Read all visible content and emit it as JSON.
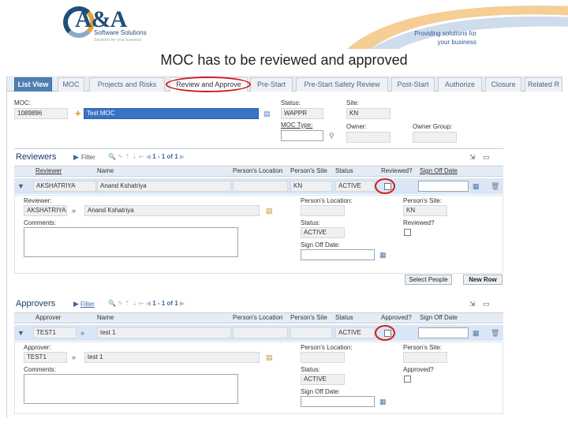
{
  "header": {
    "logo_text": "A&A",
    "logo_subtitle": "Software Solutions",
    "logo_tagline": "Solutions for your business",
    "tagline_line1": "Providing solutions for",
    "tagline_line2": "your business",
    "slide_title": "MOC has to be reviewed and approved"
  },
  "tabs": [
    {
      "label": "List View"
    },
    {
      "label": "MOC"
    },
    {
      "label": "Projects and Risks"
    },
    {
      "label": "Review and Approve"
    },
    {
      "label": "Pre-Start"
    },
    {
      "label": "Pre-Start Safety Review"
    },
    {
      "label": "Post-Start"
    },
    {
      "label": "Authorize"
    },
    {
      "label": "Closure"
    },
    {
      "label": "Related R"
    }
  ],
  "moc": {
    "moc_label": "MOC:",
    "moc_value": "1089896",
    "desc_value": "Test MOC",
    "status_label": "Status:",
    "status_value": "WAPPR",
    "site_label": "Site:",
    "site_value": "KN",
    "type_label": "MOC Type:",
    "owner_label": "Owner:",
    "owner_group_label": "Owner Group:"
  },
  "reviewers": {
    "title": "Reviewers",
    "filter": "Filter",
    "pager_text": "1 - 1 of 1",
    "columns": [
      "Reviewer",
      "Name",
      "Person's Location",
      "Person's Site",
      "Status",
      "Reviewed?",
      "Sign Off Date"
    ],
    "row": {
      "reviewer": "AKSHATRIYA",
      "name": "Anand Kshatriya",
      "location": "",
      "site": "KN",
      "status": "ACTIVE"
    },
    "detail": {
      "reviewer_label": "Reviewer:",
      "reviewer_value": "AKSHATRIYA",
      "name_value": "Anand Kshatriya",
      "location_label": "Person's Location:",
      "site_label": "Person's Site:",
      "site_value": "KN",
      "comments_label": "Comments:",
      "status_label": "Status:",
      "status_value": "ACTIVE",
      "reviewed_label": "Reviewed?",
      "signoff_label": "Sign Off Date:"
    },
    "select_people": "Select People",
    "new_row": "New Row"
  },
  "approvers": {
    "title": "Approvers",
    "filter": "Filter",
    "pager_text": "1 - 1 of 1",
    "columns": [
      "Approver",
      "Name",
      "Person's Location",
      "Person's Site",
      "Status",
      "Approved?",
      "Sign Off Date"
    ],
    "row": {
      "approver": "TEST1",
      "name": "test 1",
      "location": "",
      "site": "",
      "status": "ACTIVE"
    },
    "detail": {
      "approver_label": "Approver:",
      "approver_value": "TEST1",
      "name_value": "test 1",
      "location_label": "Person's Location:",
      "site_label": "Person's Site:",
      "comments_label": "Comments:",
      "status_label": "Status:",
      "status_value": "ACTIVE",
      "approved_label": "Approved?",
      "signoff_label": "Sign Off Date:"
    }
  },
  "colors": {
    "accent": "#4f7fb0",
    "highlight_ring": "#d02020",
    "row_selected": "#d9e6f5"
  }
}
